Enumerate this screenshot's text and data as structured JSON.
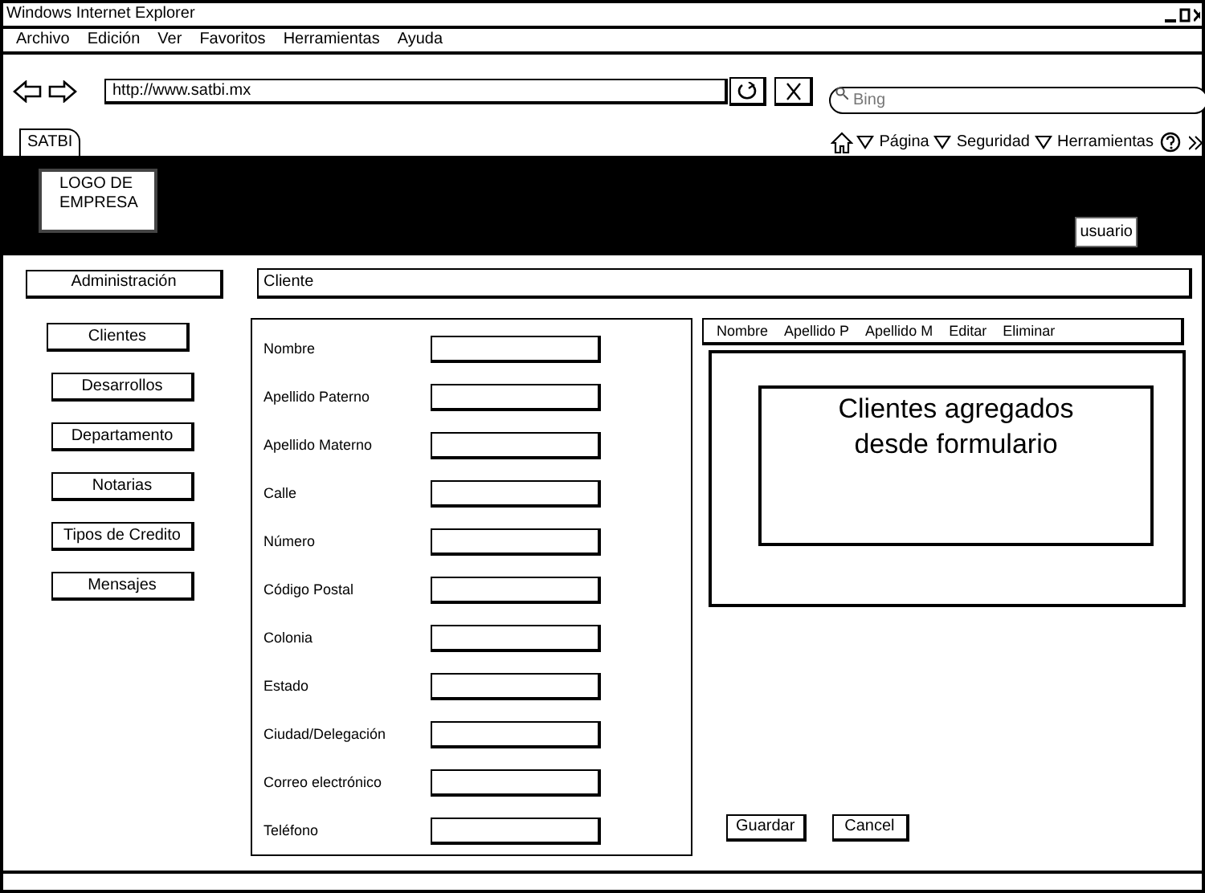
{
  "window": {
    "title": "Windows Internet Explorer"
  },
  "menu": [
    "Archivo",
    "Edición",
    "Ver",
    "Favoritos",
    "Herramientas",
    "Ayuda"
  ],
  "address": {
    "value": "http://www.satbi.mx"
  },
  "search": {
    "placeholder": "Bing"
  },
  "tabs": [
    {
      "label": "SATBI",
      "selected": true
    }
  ],
  "command_bar": [
    "Página",
    "Seguridad",
    "Herramientas"
  ],
  "header": {
    "logo": "LOGO DE EMPRESA",
    "user_button": "usuario"
  },
  "sidebar": {
    "title": "Administración",
    "items": [
      "Clientes",
      "Desarrollos",
      "Departamento",
      "Notarias",
      "Tipos de Credito",
      "Mensajes"
    ]
  },
  "section_title": "Cliente",
  "form": {
    "fields": [
      {
        "label": "Nombre"
      },
      {
        "label": "Apellido Paterno"
      },
      {
        "label": "Apellido Materno"
      },
      {
        "label": "Calle"
      },
      {
        "label": "Número"
      },
      {
        "label": "Código Postal"
      },
      {
        "label": "Colonia"
      },
      {
        "label": "Estado"
      },
      {
        "label": "Ciudad/Delegación"
      },
      {
        "label": "Correo electrónico"
      },
      {
        "label": "Teléfono"
      }
    ]
  },
  "table": {
    "columns": [
      "Nombre",
      "Apellido P",
      "Apellido M",
      "Editar",
      "Eliminar"
    ],
    "placeholder_text": "Clientes agregados desde formulario"
  },
  "buttons": [
    "Guardar",
    "Cancel"
  ]
}
